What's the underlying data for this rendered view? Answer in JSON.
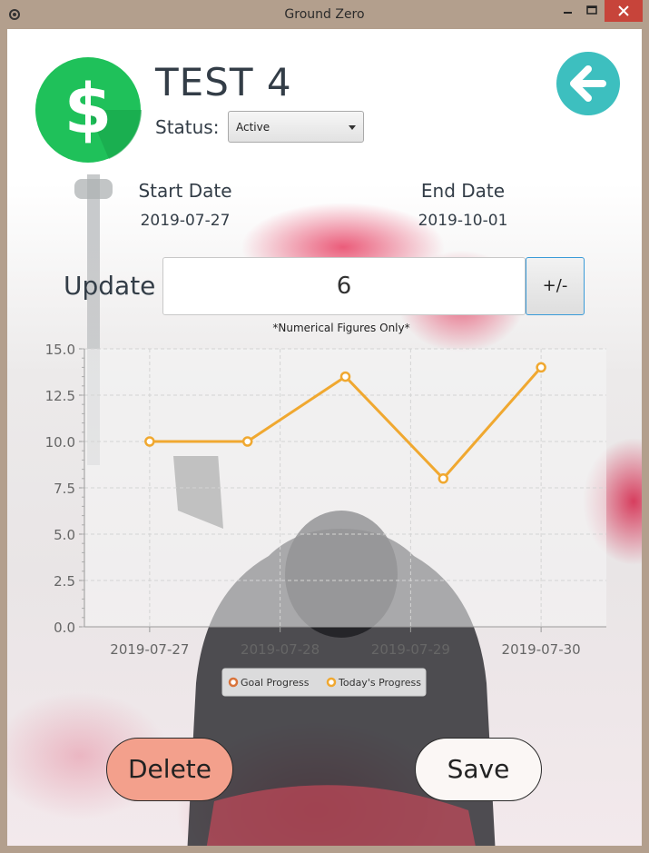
{
  "window": {
    "title": "Ground Zero",
    "icon": "gear-icon"
  },
  "header": {
    "title": "TEST 4",
    "logo_icon": "dollar-sign-icon",
    "back_icon": "arrow-left-icon",
    "status_label": "Status:",
    "status_value": "Active"
  },
  "dates": {
    "start_label": "Start Date",
    "start_value": "2019-07-27",
    "end_label": "End Date",
    "end_value": "2019-10-01"
  },
  "update": {
    "label": "Update",
    "value": "6",
    "plusminus_label": "+/-",
    "hint": "*Numerical Figures Only*"
  },
  "chart_data": {
    "type": "line",
    "categories": [
      "2019-07-27",
      "2019-07-28",
      "2019-07-29",
      "2019-07-30"
    ],
    "x": [
      "2019-07-27",
      "2019-07-27",
      "2019-07-28",
      "2019-07-29",
      "2019-07-29",
      "2019-07-30"
    ],
    "series": [
      {
        "name": "Goal Progress",
        "color": "#d9733a",
        "values": []
      },
      {
        "name": "Today's Progress",
        "color": "#f0a830",
        "values": [
          10.0,
          10.0,
          13.5,
          8.0,
          14.0
        ]
      }
    ],
    "ylim": [
      0,
      15
    ],
    "yticks": [
      "0.0",
      "2.5",
      "5.0",
      "7.5",
      "10.0",
      "12.5",
      "15.0"
    ],
    "legend_position": "bottom",
    "grid": true
  },
  "actions": {
    "delete_label": "Delete",
    "save_label": "Save"
  },
  "colors": {
    "logo_green": "#1fc15a",
    "back_teal": "#3dbfbf",
    "delete_bg": "#f3a08c",
    "line_orange": "#f0a830"
  }
}
